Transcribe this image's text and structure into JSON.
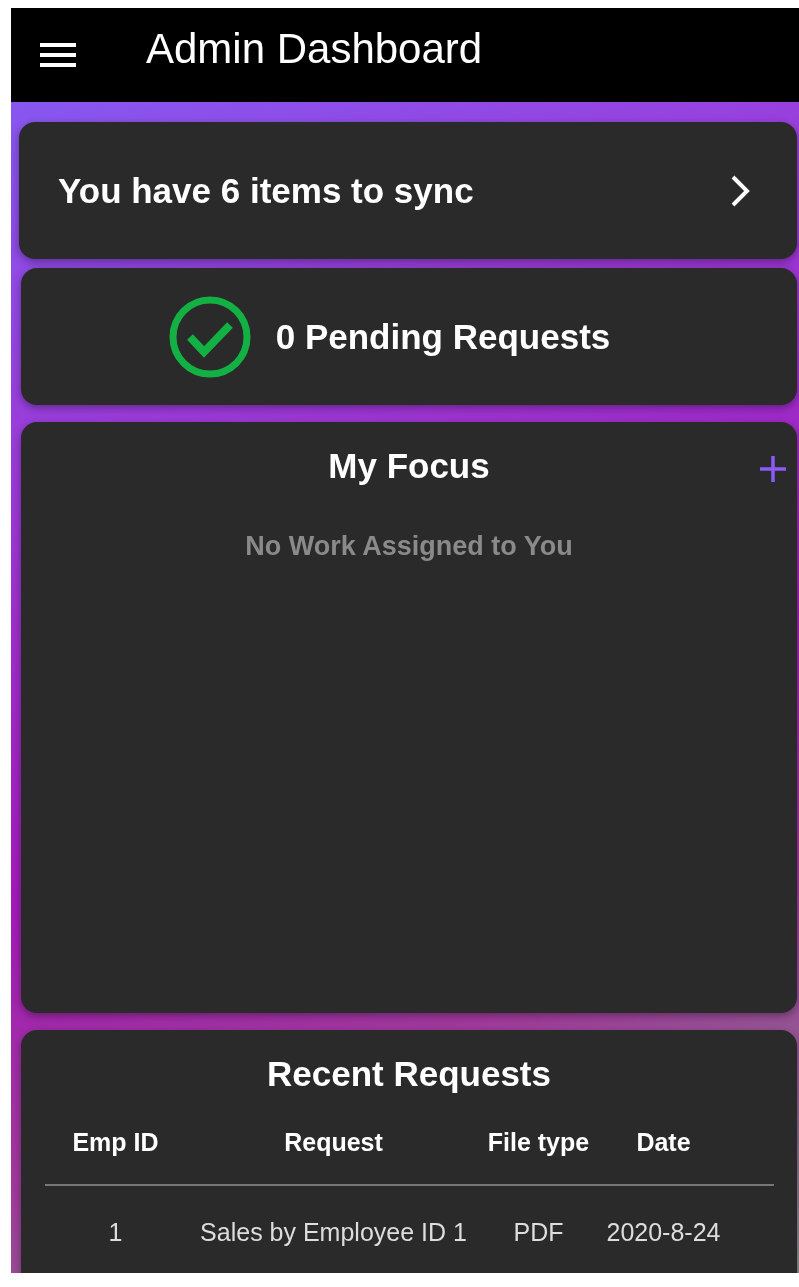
{
  "app_bar": {
    "title": "Admin Dashboard"
  },
  "sync_card": {
    "text": "You have 6 items to sync"
  },
  "pending_card": {
    "text": "0 Pending Requests"
  },
  "focus_card": {
    "title": "My Focus",
    "empty_message": "No Work Assigned to You"
  },
  "recent_requests": {
    "title": "Recent Requests",
    "columns": [
      "Emp ID",
      "Request",
      "File type",
      "Date"
    ],
    "rows": [
      {
        "cells": [
          "1",
          "Sales by Employee ID 1",
          "PDF",
          "2020-8-24"
        ]
      }
    ]
  }
}
